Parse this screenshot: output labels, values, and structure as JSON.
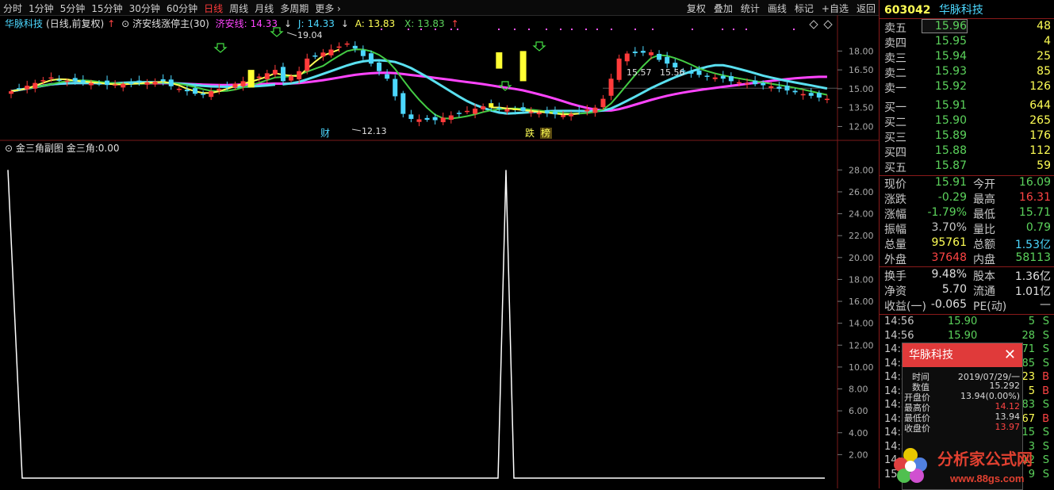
{
  "toolbar": {
    "periods": [
      "分时",
      "1分钟",
      "5分钟",
      "15分钟",
      "30分钟",
      "60分钟",
      "日线",
      "周线",
      "月线",
      "多周期",
      "更多"
    ],
    "active_period": "日线",
    "tools": [
      "复权",
      "叠加",
      "统计",
      "画线",
      "标记",
      "+自选",
      "返回"
    ]
  },
  "main_chart": {
    "stock_name": "华脉科技",
    "mode": "(日线,前复权)",
    "indicator_name": "济安线涨停主(30)",
    "jaxian_label": "济安线:",
    "jaxian_value": "14.33",
    "j_label": "J:",
    "j_value": "14.33",
    "a_label": "A:",
    "a_value": "13.83",
    "x_label": "X:",
    "x_value": "13.83",
    "y_ticks": [
      "18.00",
      "16.50",
      "15.00",
      "13.50",
      "12.00"
    ],
    "annotations": {
      "high": "19.04",
      "low": "12.13",
      "mid1": "15.57",
      "mid2": "15.56"
    },
    "markers": [
      "财",
      "跌",
      "榜"
    ]
  },
  "sub_chart": {
    "title": "金三角副图",
    "series_label": "金三角:",
    "series_value": "0.00",
    "y_ticks": [
      "28.00",
      "26.00",
      "24.00",
      "22.00",
      "20.00",
      "18.00",
      "16.00",
      "14.00",
      "12.00",
      "10.00",
      "8.00",
      "6.00",
      "4.00",
      "2.00"
    ],
    "spike_value": 28.0
  },
  "quote": {
    "code": "603042",
    "name": "华脉科技",
    "input_value": "15.96",
    "sell": [
      {
        "label": "卖五",
        "price": "15.96",
        "vol": "48"
      },
      {
        "label": "卖四",
        "price": "15.95",
        "vol": "4"
      },
      {
        "label": "卖三",
        "price": "15.94",
        "vol": "25"
      },
      {
        "label": "卖二",
        "price": "15.93",
        "vol": "85"
      },
      {
        "label": "卖一",
        "price": "15.92",
        "vol": "126"
      }
    ],
    "buy": [
      {
        "label": "买一",
        "price": "15.91",
        "vol": "644"
      },
      {
        "label": "买二",
        "price": "15.90",
        "vol": "265"
      },
      {
        "label": "买三",
        "price": "15.89",
        "vol": "176"
      },
      {
        "label": "买四",
        "price": "15.88",
        "vol": "112"
      },
      {
        "label": "买五",
        "price": "15.87",
        "vol": "59"
      }
    ],
    "stats": [
      {
        "l1": "现价",
        "v1": "15.91",
        "c1": "#5cd35c",
        "l2": "今开",
        "v2": "16.09",
        "c2": "#5cd35c"
      },
      {
        "l1": "涨跌",
        "v1": "-0.29",
        "c1": "#5cd35c",
        "l2": "最高",
        "v2": "16.31",
        "c2": "#ff4444"
      },
      {
        "l1": "涨幅",
        "v1": "-1.79%",
        "c1": "#5cd35c",
        "l2": "最低",
        "v2": "15.71",
        "c2": "#5cd35c"
      },
      {
        "l1": "振幅",
        "v1": "3.70%",
        "c1": "#c8c8c8",
        "l2": "量比",
        "v2": "0.79",
        "c2": "#5cd35c"
      },
      {
        "l1": "总量",
        "v1": "95761",
        "c1": "#ffff55",
        "l2": "总额",
        "v2": "1.53亿",
        "c2": "#4cd8ff"
      },
      {
        "l1": "外盘",
        "v1": "37648",
        "c1": "#ff4444",
        "l2": "内盘",
        "v2": "58113",
        "c2": "#5cd35c"
      }
    ],
    "stats2": [
      {
        "l1": "换手",
        "v1": "9.48%",
        "l2": "股本",
        "v2": "1.36亿"
      },
      {
        "l1": "净资",
        "v1": "5.70",
        "l2": "流通",
        "v2": "1.01亿"
      },
      {
        "l1": "收益(一)",
        "v1": "-0.065",
        "l2": "PE(动)",
        "v2": "—"
      }
    ],
    "ticks": [
      {
        "t": "14:56",
        "p": "15.90",
        "q": "5",
        "s": "S"
      },
      {
        "t": "14:56",
        "p": "15.90",
        "q": "28",
        "s": "S"
      },
      {
        "t": "14:56",
        "p": "15.90",
        "q": "71",
        "s": "S"
      },
      {
        "t": "14:56",
        "p": "15.90",
        "q": "85",
        "s": "S"
      },
      {
        "t": "14:57",
        "p": "15.91",
        "q": "23",
        "s": "B"
      },
      {
        "t": "14:57",
        "p": "15.91",
        "q": "5",
        "s": "B"
      },
      {
        "t": "14:57",
        "p": "15.90",
        "q": "83",
        "s": "S"
      },
      {
        "t": "14:57",
        "p": "15.91",
        "q": "67",
        "s": "B"
      },
      {
        "t": "14:58",
        "p": "15.91",
        "q": "15",
        "s": "S"
      },
      {
        "t": "14:58",
        "p": "15.91",
        "q": "3",
        "s": "S"
      },
      {
        "t": "14:59",
        "p": "15.91",
        "q": "12",
        "s": "S"
      },
      {
        "t": "15:00",
        "p": "15.91",
        "q": "9",
        "s": "S"
      }
    ]
  },
  "popup": {
    "title": "华脉科技",
    "rows": [
      {
        "k": "时间",
        "v": "2019/07/29/一",
        "c": "#d8d8d8"
      },
      {
        "k": "数值",
        "v": "15.292",
        "c": "#d8d8d8"
      },
      {
        "k": "开盘价",
        "v": "13.94(0.00%)",
        "c": "#d8d8d8"
      },
      {
        "k": "最高价",
        "v": "14.12",
        "c": "#ff4444"
      },
      {
        "k": "最低价",
        "v": "13.94",
        "c": "#d8d8d8"
      },
      {
        "k": "收盘价",
        "v": "13.97",
        "c": "#ff4444"
      }
    ]
  },
  "watermark": {
    "text": "分析家公式网",
    "url": "www.88gs.com"
  },
  "colors": {
    "up": "#ff3b3b",
    "down": "#4cd8ff",
    "ma_yellow": "#ffff55",
    "ma_magenta": "#ff44ff",
    "ma_cyan": "#5ae0f0",
    "ma_green": "#44cc44"
  }
}
